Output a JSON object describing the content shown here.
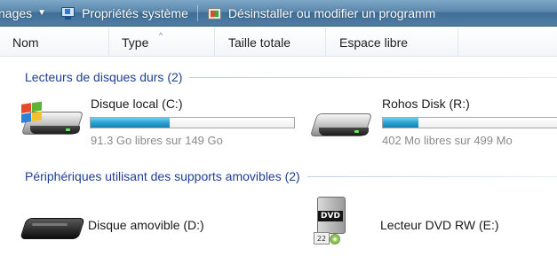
{
  "toolbar": {
    "items": [
      {
        "label": "nages",
        "has_arrow": true
      },
      {
        "label": "Propriétés système"
      },
      {
        "label": "Désinstaller ou modifier un programm"
      }
    ]
  },
  "columns": [
    "Nom",
    "Type",
    "Taille totale",
    "Espace libre"
  ],
  "groups": [
    {
      "title": "Lecteurs de disques durs (2)",
      "drives": [
        {
          "name": "Disque local (C:)",
          "free_text": "91.3 Go libres sur 149 Go",
          "used_fraction": 0.39,
          "icon": "hard-disk-windows-icon"
        },
        {
          "name": "Rohos Disk (R:)",
          "free_text": "402 Mo libres sur 499 Mo",
          "used_fraction": 0.19,
          "icon": "hard-disk-icon"
        }
      ]
    },
    {
      "title": "Périphériques utilisant des supports amovibles (2)",
      "drives": [
        {
          "name": "Disque amovible (D:)",
          "icon": "removable-disk-icon"
        },
        {
          "name": "Lecteur DVD RW (E:)",
          "icon": "dvd-drive-icon",
          "badge_text": "DVD",
          "calendar_text": "22"
        }
      ]
    }
  ],
  "colors": {
    "toolbar": "#4d7ea6",
    "group_title": "#1e3f94",
    "bar_fill": "#2aa0cf",
    "free_text": "#8a8a8a"
  }
}
